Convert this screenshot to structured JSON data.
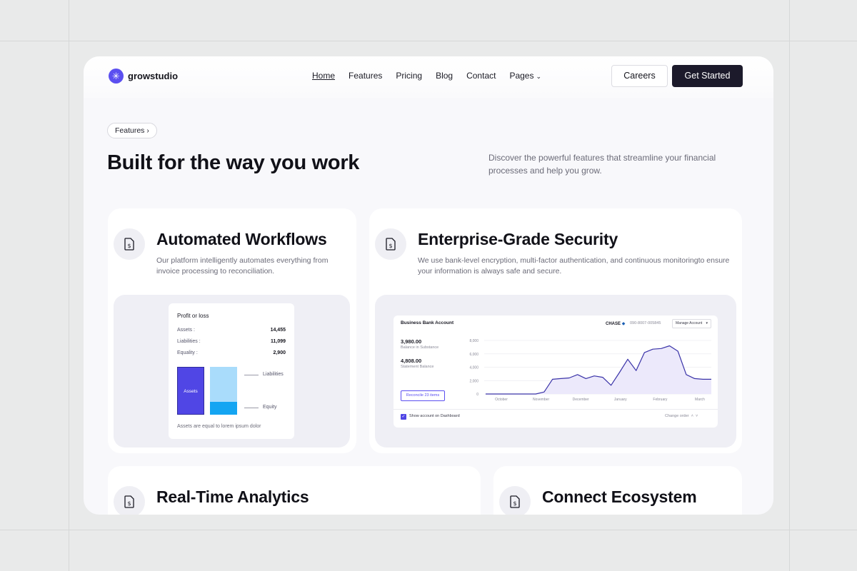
{
  "brand": {
    "name": "growstudio",
    "logo_icon": "asterisk-logo-icon",
    "accent": "#5b4ff0"
  },
  "nav": {
    "items": [
      {
        "label": "Home",
        "active": true
      },
      {
        "label": "Features"
      },
      {
        "label": "Pricing"
      },
      {
        "label": "Blog"
      },
      {
        "label": "Contact"
      },
      {
        "label": "Pages"
      }
    ],
    "careers_label": "Careers",
    "cta_label": "Get Started"
  },
  "hero": {
    "pill": "Features",
    "title": "Built for the way you work",
    "description": "Discover the powerful features that streamline your financial processes and help you grow."
  },
  "cards": [
    {
      "title": "Automated Workflows",
      "description": "Our platform intelligently automates everything from invoice processing to reconciliation.",
      "icon": "dollar-document-icon"
    },
    {
      "title": "Enterprise-Grade Security",
      "description": "We use bank-level encryption, multi-factor authentication, and continuous monitoringto ensure your information is always safe and secure.",
      "icon": "dollar-document-icon"
    },
    {
      "title": "Real-Time Analytics",
      "icon": "dollar-document-icon"
    },
    {
      "title": "Connect Ecosystem",
      "icon": "dollar-document-icon"
    }
  ],
  "profit_loss": {
    "title": "Profit or loss",
    "rows": [
      {
        "label": "Assets :",
        "value": "14,455"
      },
      {
        "label": "Liabilities :",
        "value": "11,099"
      },
      {
        "label": "Equality :",
        "value": "2,900"
      }
    ],
    "bar_label": "Assets",
    "legend": [
      "Liabilities",
      "Equity"
    ],
    "footer": "Assets are equal to lorem ipsum dolor",
    "colors": {
      "assets": "#5046e5",
      "liabilities": "#a9dcfb",
      "equity": "#14a5f2"
    }
  },
  "bank": {
    "title": "Business Bank Account",
    "bank_name": "CHASE",
    "account_number": "090-8007-005845",
    "manage_label": "Manage Account",
    "balance_1": {
      "value": "3,980.00",
      "label": "Balance in Substance"
    },
    "balance_2": {
      "value": "4,808.00",
      "label": "Statement Balance"
    },
    "reconcile_label": "Reconcile 23 items",
    "show_label": "Show account on Dashboard",
    "change_order_label": "Change order"
  },
  "chart_data": {
    "type": "area",
    "x": [
      "October",
      "November",
      "December",
      "January",
      "February",
      "March"
    ],
    "y_ticks": [
      "8,000",
      "6,000",
      "4,000",
      "2,000",
      "0"
    ],
    "ylim": [
      0,
      8000
    ],
    "grid": true,
    "series": [
      {
        "values": [
          0,
          0,
          0,
          0,
          0,
          0,
          0,
          300,
          2200,
          2300,
          2400,
          2900,
          2300,
          2700,
          2500,
          1300,
          3200,
          5200,
          3500,
          6200,
          6700,
          6800,
          7200,
          6400,
          2900,
          2300,
          2200,
          2200
        ]
      }
    ],
    "color": "#3a33a8",
    "fill": "#ece9fb"
  }
}
